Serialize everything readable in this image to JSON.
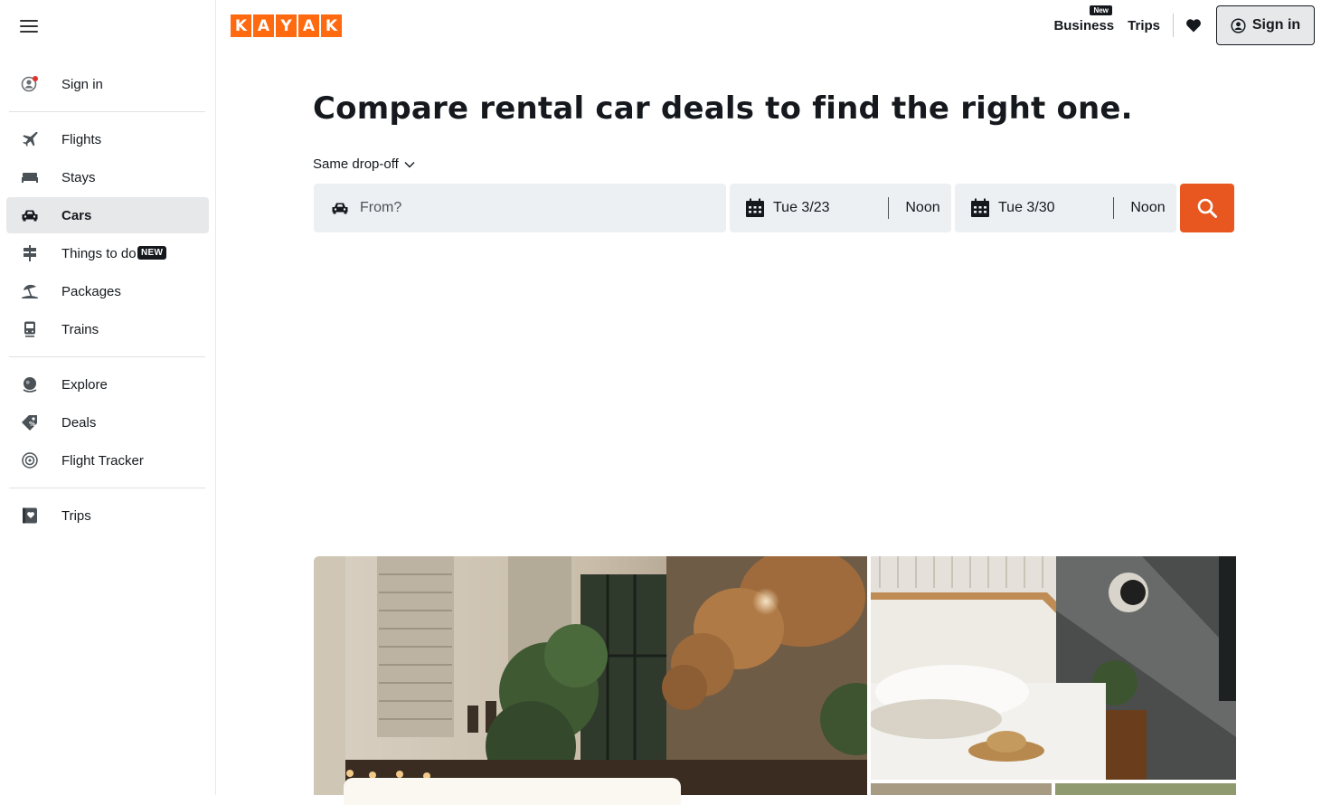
{
  "brand": {
    "letters": [
      "K",
      "A",
      "Y",
      "A",
      "K"
    ],
    "accent_color": "#ff690f"
  },
  "sidebar": {
    "menu_icon": "hamburger-icon",
    "sign_in": {
      "label": "Sign in",
      "icon": "user-circle-icon"
    },
    "items": [
      {
        "label": "Flights",
        "icon": "plane-icon"
      },
      {
        "label": "Stays",
        "icon": "bed-icon"
      },
      {
        "label": "Cars",
        "icon": "car-icon",
        "active": true
      },
      {
        "label": "Things to do",
        "icon": "signpost-icon",
        "badge": "NEW"
      },
      {
        "label": "Packages",
        "icon": "beach-umbrella-icon"
      },
      {
        "label": "Trains",
        "icon": "train-icon"
      }
    ],
    "tools": [
      {
        "label": "Explore",
        "icon": "globe-icon"
      },
      {
        "label": "Deals",
        "icon": "deal-tag-icon"
      },
      {
        "label": "Flight Tracker",
        "icon": "radar-icon"
      }
    ],
    "trips": {
      "label": "Trips",
      "icon": "trips-heart-icon"
    }
  },
  "header": {
    "business": {
      "label": "Business",
      "badge": "New"
    },
    "trips_label": "Trips",
    "favorites_icon": "heart-icon",
    "sign_in_label": "Sign in"
  },
  "main": {
    "headline": "Compare rental car deals to find the right one.",
    "dropoff_selector": "Same drop-off",
    "search": {
      "from_placeholder": "From?",
      "pickup_date": "Tue 3/23",
      "pickup_time": "Noon",
      "dropoff_date": "Tue 3/30",
      "dropoff_time": "Noon",
      "button_color": "#e8571f"
    }
  }
}
